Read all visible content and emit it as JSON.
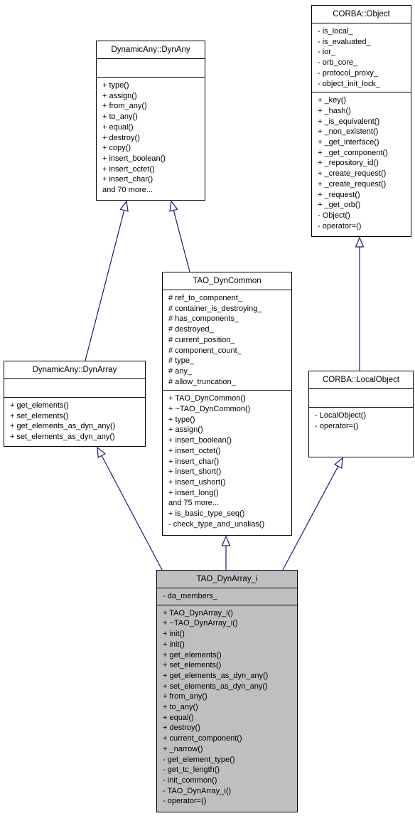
{
  "diagram": {
    "type": "uml-inheritance",
    "edge_color": "#1a1a7a",
    "focus_fill": "#bfbfbf",
    "classes": {
      "dynany": {
        "name": "DynamicAny::DynAny",
        "attributes": [],
        "methods": [
          "+ type()",
          "+ assign()",
          "+ from_any()",
          "+ to_any()",
          "+ equal()",
          "+ destroy()",
          "+ copy()",
          "+ insert_boolean()",
          "+ insert_octet()",
          "+ insert_char()",
          "and 70 more..."
        ]
      },
      "corba_object": {
        "name": "CORBA::Object",
        "attributes": [
          "- is_local_",
          "- is_evaluated_",
          "- ior_",
          "- orb_core_",
          "- protocol_proxy_",
          "- object_init_lock_"
        ],
        "methods": [
          "+ _key()",
          "+ _hash()",
          "+ _is_equivalent()",
          "+ _non_existent()",
          "+ _get_interface()",
          "+ _get_component()",
          "+ _repository_id()",
          "+ _create_request()",
          "+ _create_request()",
          "+ _request()",
          "+ _get_orb()",
          "- Object()",
          "- operator=()"
        ]
      },
      "dyncommon": {
        "name": "TAO_DynCommon",
        "attributes": [
          "# ref_to_component_",
          "# container_is_destroying_",
          "# has_components_",
          "# destroyed_",
          "# current_position_",
          "# component_count_",
          "# type_",
          "# any_",
          "# allow_truncation_"
        ],
        "methods": [
          "+ TAO_DynCommon()",
          "+ ~TAO_DynCommon()",
          "+ type()",
          "+ assign()",
          "+ insert_boolean()",
          "+ insert_octet()",
          "+ insert_char()",
          "+ insert_short()",
          "+ insert_ushort()",
          "+ insert_long()",
          "and 75 more...",
          "+ is_basic_type_seq()",
          "- check_type_and_unalias()"
        ]
      },
      "dynarray": {
        "name": "DynamicAny::DynArray",
        "attributes": [],
        "methods": [
          "+ get_elements()",
          "+ set_elements()",
          "+ get_elements_as_dyn_any()",
          "+ set_elements_as_dyn_any()"
        ]
      },
      "localobject": {
        "name": "CORBA::LocalObject",
        "attributes": [],
        "methods": [
          "- LocalObject()",
          "- operator=()"
        ]
      },
      "dynarray_i": {
        "name": "TAO_DynArray_i",
        "attributes": [
          "- da_members_"
        ],
        "methods": [
          "+ TAO_DynArray_i()",
          "+ ~TAO_DynArray_i()",
          "+ init()",
          "+ init()",
          "+ get_elements()",
          "+ set_elements()",
          "+ get_elements_as_dyn_any()",
          "+ set_elements_as_dyn_any()",
          "+ from_any()",
          "+ to_any()",
          "+ equal()",
          "+ destroy()",
          "+ current_component()",
          "+ _narrow()",
          "- get_element_type()",
          "- get_tc_length()",
          "- init_common()",
          "- TAO_DynArray_i()",
          "- operator=()"
        ]
      }
    },
    "inheritance": [
      {
        "child": "dynarray",
        "parent": "dynany"
      },
      {
        "child": "dyncommon",
        "parent": "dynany"
      },
      {
        "child": "localobject",
        "parent": "corba_object"
      },
      {
        "child": "dynarray_i",
        "parent": "dynarray"
      },
      {
        "child": "dynarray_i",
        "parent": "dyncommon"
      },
      {
        "child": "dynarray_i",
        "parent": "localobject"
      }
    ]
  }
}
